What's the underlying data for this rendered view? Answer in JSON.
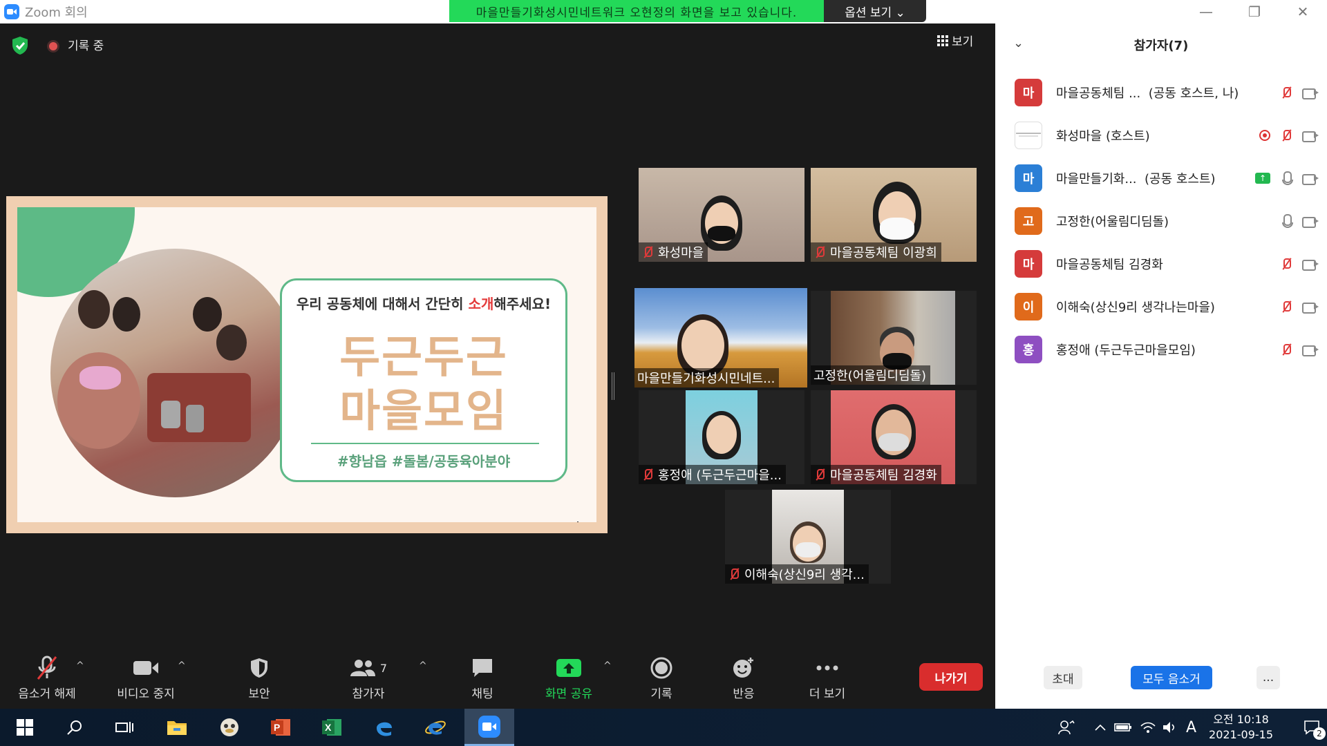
{
  "window": {
    "title": "Zoom 회의"
  },
  "banner": {
    "text": "마을만들기화성시민네트워크 오현정의 화면을 보고 있습니다.",
    "options_label": "옵션 보기 ⌄"
  },
  "window_controls": {
    "minimize": "—",
    "restore": "❐",
    "close": "✕"
  },
  "meeting": {
    "recording_label": "기록 중",
    "view_label": "보기"
  },
  "slide": {
    "question_before": "우리 공동체에 대해서 간단히 ",
    "question_highlight": "소개",
    "question_after": "해주세요!",
    "title_line1": "두근두근",
    "title_line2": "마을모임",
    "tags": "#향남읍  #돌봄/공동육아분야"
  },
  "tiles": [
    {
      "label": "화성마을",
      "muted": true
    },
    {
      "label": "마을공동체팀 이광희",
      "muted": true
    },
    {
      "label": "마을만들기화성시민네트...",
      "muted": false,
      "active_speaker": true
    },
    {
      "label": "고정한(어울림디딤돌)",
      "muted": false
    },
    {
      "label": "홍정애 (두근두근마을...",
      "muted": true
    },
    {
      "label": "마을공동체팀 김경화",
      "muted": true
    },
    {
      "label": "이해숙(상신9리 생각...",
      "muted": true
    }
  ],
  "toolbar": {
    "unmute": "음소거 해제",
    "stop_video": "비디오 중지",
    "security": "보안",
    "participants": "참가자",
    "participants_count": "7",
    "chat": "채팅",
    "share": "화면 공유",
    "record": "기록",
    "reactions": "반응",
    "more": "더 보기",
    "leave": "나가기"
  },
  "panel": {
    "title": "참가자(7)",
    "participants": [
      {
        "initial": "마",
        "color": "#d53b3b",
        "name": "마을공동체팀 ...",
        "role": "(공동 호스트, 나)",
        "mic": "muted",
        "cam": "off"
      },
      {
        "initial": "",
        "color": "#ffffff",
        "name": "화성마을 (호스트)",
        "role": "",
        "mic": "muted",
        "cam": "off",
        "recording": true,
        "logo": true
      },
      {
        "initial": "마",
        "color": "#2b7fd6",
        "name": "마을만들기화...",
        "role": "(공동 호스트)",
        "mic": "on",
        "cam": "off",
        "sharing": true
      },
      {
        "initial": "고",
        "color": "#e06a1b",
        "name": "고정한(어울림디딤돌)",
        "role": "",
        "mic": "on",
        "cam": "off"
      },
      {
        "initial": "마",
        "color": "#d53b3b",
        "name": "마을공동체팀 김경화",
        "role": "",
        "mic": "muted",
        "cam": "off"
      },
      {
        "initial": "이",
        "color": "#e06a1b",
        "name": "이해숙(상신9리 생각나는마을)",
        "role": "",
        "mic": "muted",
        "cam": "off"
      },
      {
        "initial": "홍",
        "color": "#8e4fc1",
        "name": "홍정애 (두근두근마을모임)",
        "role": "",
        "mic": "muted",
        "cam": "off"
      }
    ],
    "invite": "초대",
    "mute_all": "모두 음소거",
    "more": "..."
  },
  "taskbar": {
    "time": "오전 10:18",
    "date": "2021-09-15",
    "ime": "A",
    "notification_count": "2"
  },
  "colors": {
    "share_green": "#23d959",
    "leave_red": "#d92d2d",
    "speaker_outline": "#e6e94a",
    "mute_all_blue": "#1a73e8"
  }
}
